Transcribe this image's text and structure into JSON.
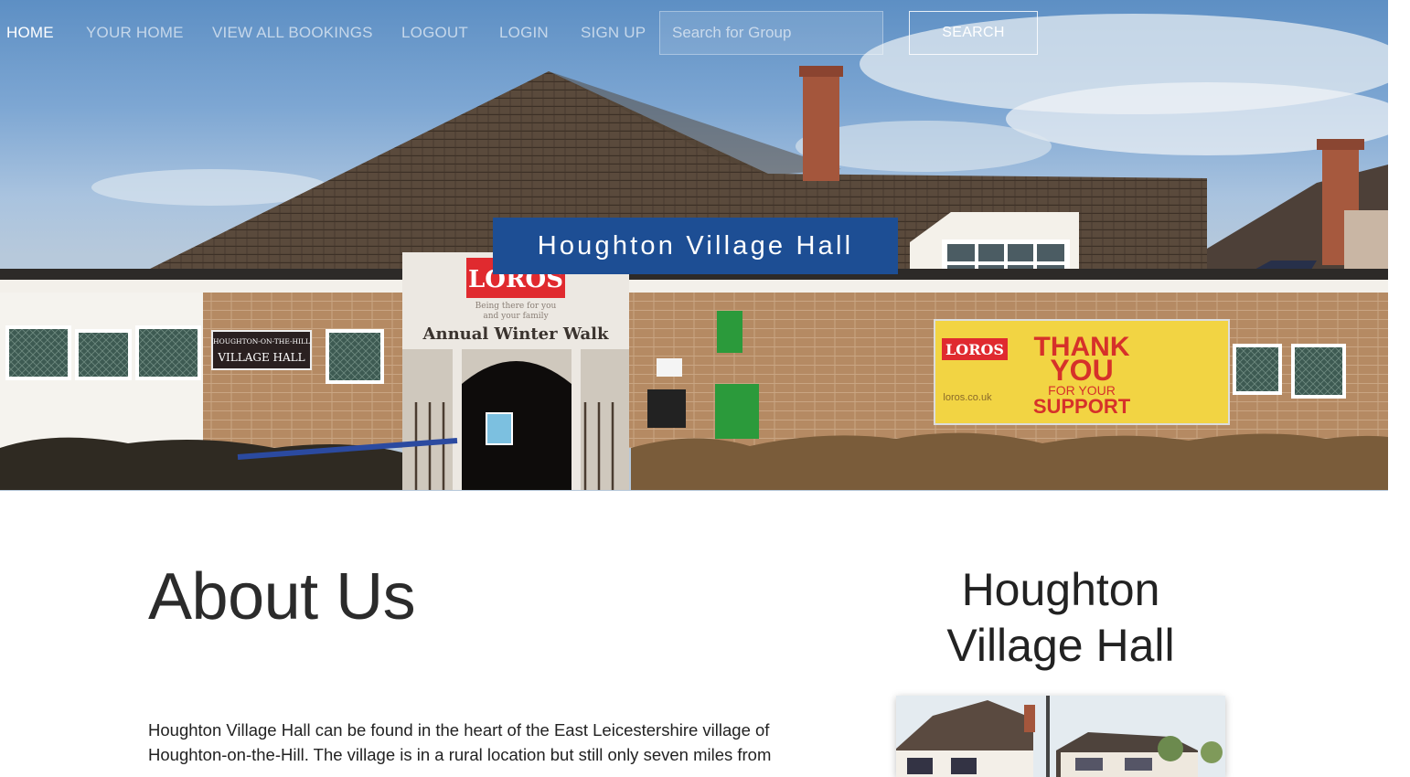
{
  "nav": {
    "items": [
      {
        "label": "HOME",
        "active": true
      },
      {
        "label": "YOUR HOME",
        "active": false
      },
      {
        "label": "VIEW ALL BOOKINGS",
        "active": false
      },
      {
        "label": "LOGOUT",
        "active": false
      },
      {
        "label": "LOGIN",
        "active": false
      },
      {
        "label": "SIGN UP",
        "active": false
      }
    ],
    "search_placeholder": "Search for Group",
    "search_button_label": "SEARCH"
  },
  "hero": {
    "title": "Houghton Village Hall",
    "title_bg_color": "#1d4e94",
    "image_signs": {
      "banner_brand": "LOROS",
      "banner_tagline_1": "Being there for you",
      "banner_tagline_2": "and your family",
      "banner_event": "Annual Winter Walk",
      "hall_sign_1": "HOUGHTON-ON-THE-HILL",
      "hall_sign_2": "VILLAGE HALL",
      "thanks_brand": "LOROS",
      "thanks_1": "THANK",
      "thanks_2": "YOU",
      "thanks_3": "FOR YOUR",
      "thanks_4": "SUPPORT",
      "thanks_site": "loros.co.uk"
    }
  },
  "about": {
    "heading": "About Us",
    "text": "Houghton Village Hall can be found in the heart of the East Leicestershire village of Houghton-on-the-Hill. The village is in a rural location but still only seven miles from"
  },
  "sidebar": {
    "title": "Houghton Village Hall"
  }
}
